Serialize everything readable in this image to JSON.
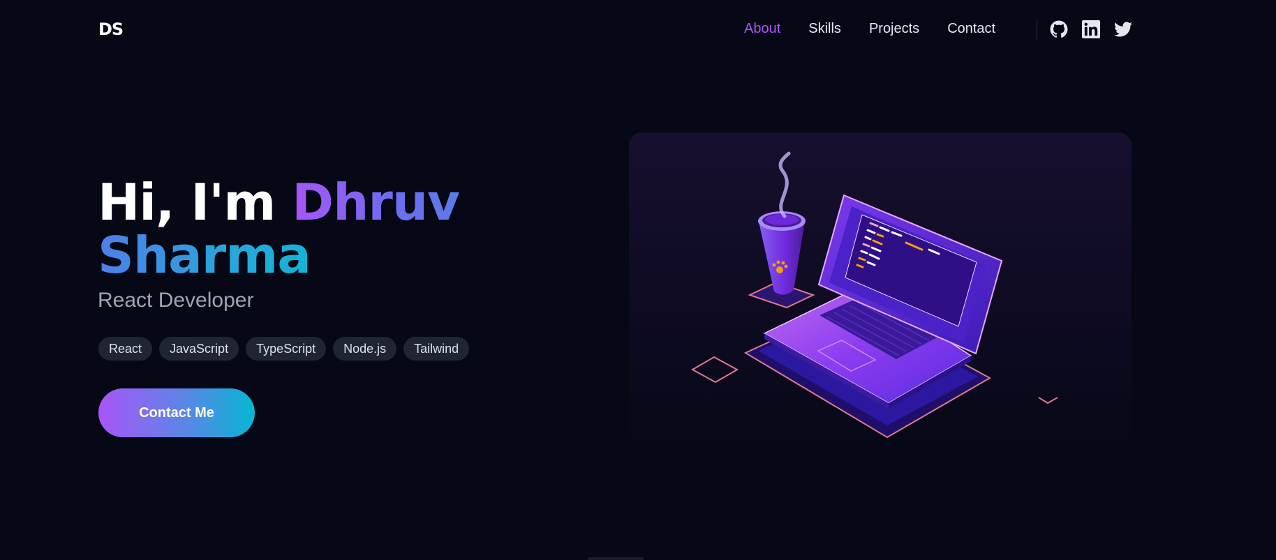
{
  "nav": {
    "logo": "DS",
    "links": [
      {
        "label": "About",
        "active": true
      },
      {
        "label": "Skills",
        "active": false
      },
      {
        "label": "Projects",
        "active": false
      },
      {
        "label": "Contact",
        "active": false
      }
    ],
    "socials": [
      {
        "icon": "github-icon"
      },
      {
        "icon": "linkedin-icon"
      },
      {
        "icon": "twitter-icon"
      }
    ]
  },
  "hero": {
    "greeting": "Hi, I'm",
    "first_name": "Dhruv",
    "last_name": "Sharma",
    "role": "React Developer",
    "skills": [
      "React",
      "JavaScript",
      "TypeScript",
      "Node.js",
      "Tailwind"
    ],
    "cta_label": "Contact Me"
  },
  "illustration": {
    "subject": "isometric laptop with coffee cup"
  },
  "colors": {
    "background": "#060816",
    "accent_purple": "#a855f7",
    "accent_cyan": "#06b6d4",
    "tag_bg": "#1f2533"
  }
}
